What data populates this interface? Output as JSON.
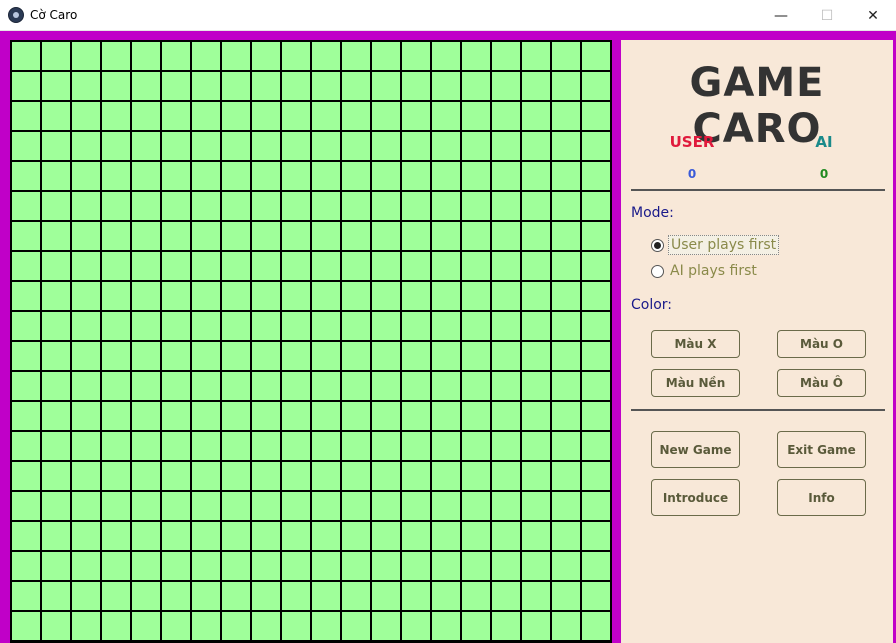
{
  "window": {
    "title": "Cờ Caro",
    "minimize_glyph": "—",
    "maximize_glyph": "☐",
    "close_glyph": "✕"
  },
  "board": {
    "rows": 20,
    "cols": 20
  },
  "panel": {
    "title": "GAME CARO",
    "score": {
      "user_label": "USER",
      "ai_label": "AI",
      "user_value": "0",
      "ai_value": "0"
    },
    "mode": {
      "label": "Mode:",
      "options": [
        "User plays first",
        "AI plays first"
      ],
      "selected": "User plays first"
    },
    "color": {
      "label": "Color:",
      "buttons": [
        "Màu X",
        "Màu O",
        "Màu Nền",
        "Màu Ô"
      ]
    },
    "actions": {
      "new_game": "New Game",
      "exit_game": "Exit Game",
      "introduce": "Introduce",
      "info": "Info"
    }
  },
  "colors": {
    "frame": "#c000c8",
    "board_cell": "#9fff9a",
    "grid_line": "#000000",
    "panel_bg": "#f8e8d8",
    "user_label": "#e01a3c",
    "ai_label": "#1a8a8a"
  }
}
